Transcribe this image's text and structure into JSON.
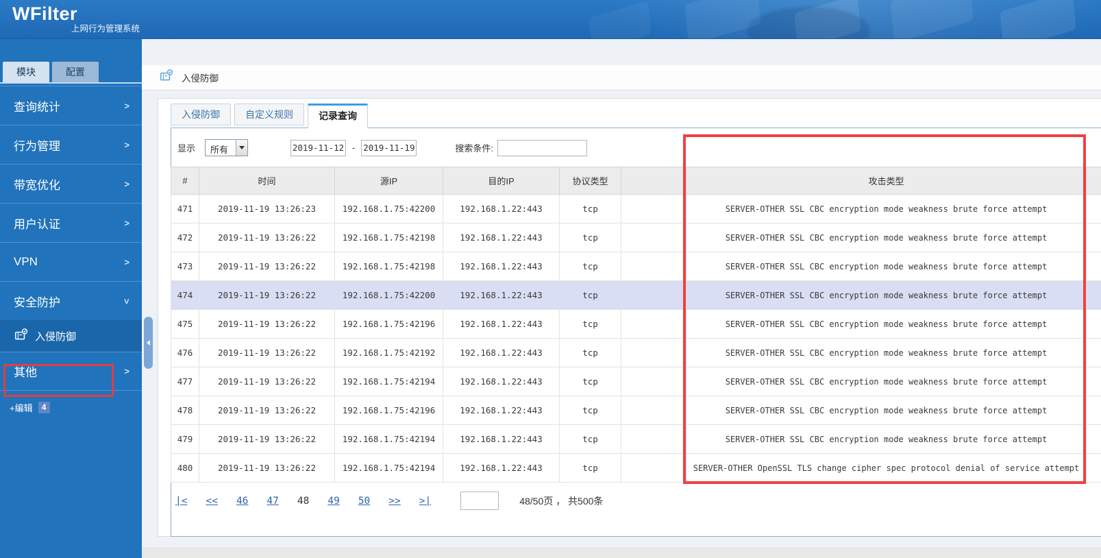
{
  "header": {
    "logo": "WFilter",
    "subtitle": "上网行为管理系统"
  },
  "sidebar": {
    "tabs": [
      {
        "label": "模块",
        "active": true
      },
      {
        "label": "配置",
        "active": false
      }
    ],
    "menu": [
      {
        "label": "查询统计",
        "type": "group",
        "expanded": false
      },
      {
        "label": "行为管理",
        "type": "group",
        "expanded": false
      },
      {
        "label": "带宽优化",
        "type": "group",
        "expanded": false
      },
      {
        "label": "用户认证",
        "type": "group",
        "expanded": false
      },
      {
        "label": "VPN",
        "type": "group",
        "expanded": false
      },
      {
        "label": "安全防护",
        "type": "group",
        "expanded": true
      },
      {
        "label": "入侵防御",
        "type": "sub",
        "icon": "package-check-icon",
        "active": true
      },
      {
        "label": "其他",
        "type": "group",
        "expanded": false
      }
    ],
    "edit_label": "+编辑",
    "edit_badge": "4"
  },
  "breadcrumb": {
    "icon": "package-check-icon",
    "title": "入侵防御"
  },
  "tabs": [
    {
      "label": "入侵防御",
      "active": false
    },
    {
      "label": "自定义规则",
      "active": false
    },
    {
      "label": "记录查询",
      "active": true
    }
  ],
  "filter": {
    "show_label": "显示",
    "show_value": "所有",
    "date_from": "2019-11-12",
    "date_separator": "-",
    "date_to": "2019-11-19",
    "search_label": "搜索条件:",
    "search_value": ""
  },
  "table": {
    "columns": [
      "#",
      "时间",
      "源IP",
      "目的IP",
      "协议类型",
      "",
      "攻击类型"
    ],
    "selected_row": "474",
    "rows": [
      [
        "471",
        "2019-11-19 13:26:23",
        "192.168.1.75:42200",
        "192.168.1.22:443",
        "tcp",
        "",
        "SERVER-OTHER SSL CBC encryption mode weakness brute force attempt"
      ],
      [
        "472",
        "2019-11-19 13:26:22",
        "192.168.1.75:42198",
        "192.168.1.22:443",
        "tcp",
        "",
        "SERVER-OTHER SSL CBC encryption mode weakness brute force attempt"
      ],
      [
        "473",
        "2019-11-19 13:26:22",
        "192.168.1.75:42198",
        "192.168.1.22:443",
        "tcp",
        "",
        "SERVER-OTHER SSL CBC encryption mode weakness brute force attempt"
      ],
      [
        "474",
        "2019-11-19 13:26:22",
        "192.168.1.75:42200",
        "192.168.1.22:443",
        "tcp",
        "",
        "SERVER-OTHER SSL CBC encryption mode weakness brute force attempt"
      ],
      [
        "475",
        "2019-11-19 13:26:22",
        "192.168.1.75:42196",
        "192.168.1.22:443",
        "tcp",
        "",
        "SERVER-OTHER SSL CBC encryption mode weakness brute force attempt"
      ],
      [
        "476",
        "2019-11-19 13:26:22",
        "192.168.1.75:42192",
        "192.168.1.22:443",
        "tcp",
        "",
        "SERVER-OTHER SSL CBC encryption mode weakness brute force attempt"
      ],
      [
        "477",
        "2019-11-19 13:26:22",
        "192.168.1.75:42194",
        "192.168.1.22:443",
        "tcp",
        "",
        "SERVER-OTHER SSL CBC encryption mode weakness brute force attempt"
      ],
      [
        "478",
        "2019-11-19 13:26:22",
        "192.168.1.75:42196",
        "192.168.1.22:443",
        "tcp",
        "",
        "SERVER-OTHER SSL CBC encryption mode weakness brute force attempt"
      ],
      [
        "479",
        "2019-11-19 13:26:22",
        "192.168.1.75:42194",
        "192.168.1.22:443",
        "tcp",
        "",
        "SERVER-OTHER SSL CBC encryption mode weakness brute force attempt"
      ],
      [
        "480",
        "2019-11-19 13:26:22",
        "192.168.1.75:42194",
        "192.168.1.22:443",
        "tcp",
        "",
        "SERVER-OTHER OpenSSL TLS change cipher spec protocol denial of service attempt"
      ]
    ]
  },
  "pagination": {
    "first_label": "|<",
    "prev_label": "<<",
    "page_links": [
      "46",
      "47",
      "48",
      "49",
      "50"
    ],
    "current_page": "48",
    "next_label": ">>",
    "last_label": ">|",
    "page_input_value": "",
    "status_text": "48/50页 ， 共500条"
  },
  "colors": {
    "header_blue": "#2478c5",
    "sidebar_blue": "#2173bb",
    "submenu_active_blue": "#1a66aa",
    "tab_active_accent": "#3e9be4",
    "link_blue": "#2e64ad",
    "selected_row": "#d9def4",
    "annotation_red": "#f13f42"
  }
}
